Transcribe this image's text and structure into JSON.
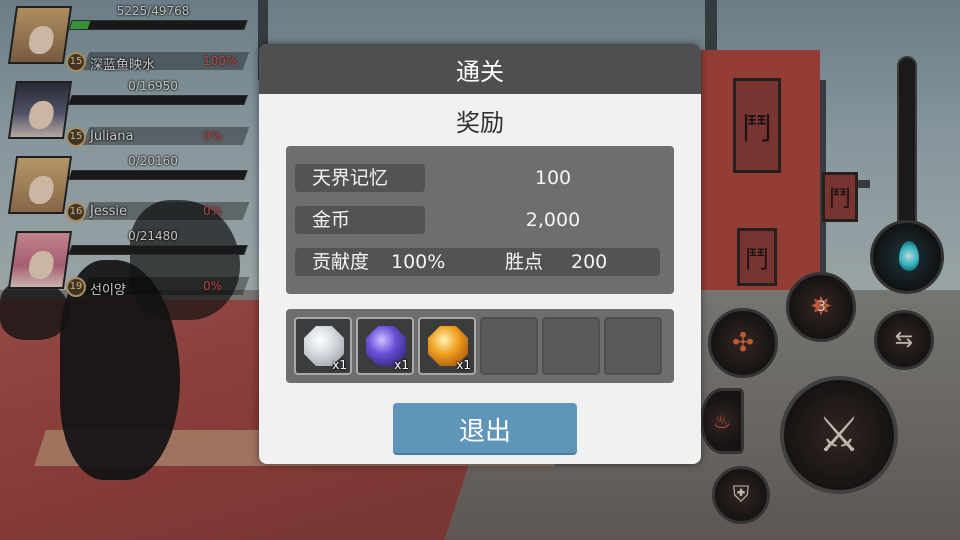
{
  "party": [
    {
      "hp_text": "5225/49768",
      "hp_fraction": 0.105,
      "level": "15",
      "name": "深蓝鱼映水",
      "percent": "100%"
    },
    {
      "hp_text": "0/16950",
      "hp_fraction": 0,
      "level": "15",
      "name": "Juliana",
      "percent": "0%"
    },
    {
      "hp_text": "0/20160",
      "hp_fraction": 0,
      "level": "16",
      "name": "Jessie",
      "percent": "0%"
    },
    {
      "hp_text": "0/21480",
      "hp_fraction": 0,
      "level": "19",
      "name": "선이양",
      "percent": "0%"
    }
  ],
  "dialog": {
    "title": "通关",
    "subtitle": "奖励",
    "rewards": {
      "memory_label": "天界记忆",
      "memory_value": "100",
      "gold_label": "金币",
      "gold_value": "2,000",
      "contribution_label": "贡献度",
      "contribution_value": "100%",
      "victory_label": "胜点",
      "victory_value": "200"
    },
    "items": [
      {
        "icon": "white-gem-icon",
        "qty": "x1"
      },
      {
        "icon": "purple-gem-icon",
        "qty": "x1"
      },
      {
        "icon": "orange-gem-icon",
        "qty": "x1"
      }
    ],
    "exit_label": "退出"
  },
  "skills": {
    "skill_charge_count": "3"
  },
  "background": {
    "banner_glyph": "鬥"
  }
}
